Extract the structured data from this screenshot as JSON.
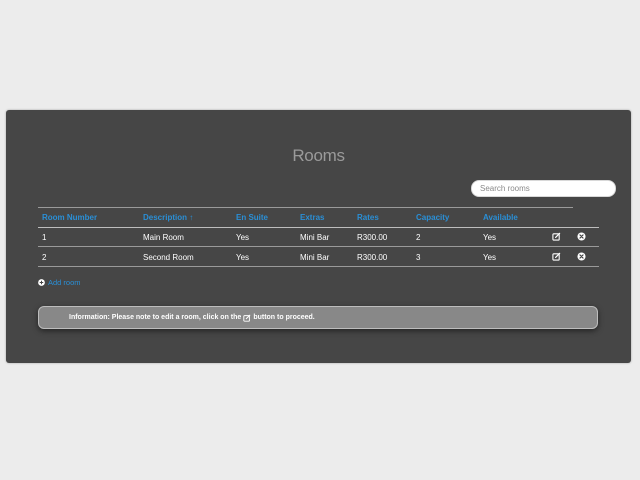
{
  "page": {
    "title": "Rooms"
  },
  "search": {
    "placeholder": "Search rooms"
  },
  "table": {
    "columns": [
      "Room Number",
      "Description ↑",
      "En Suite",
      "Extras",
      "Rates",
      "Capacity",
      "Available"
    ],
    "rows": [
      {
        "room_number": "1",
        "description": "Main Room",
        "en_suite": "Yes",
        "extras": "Mini Bar",
        "rates": "R300.00",
        "capacity": "2",
        "available": "Yes"
      },
      {
        "room_number": "2",
        "description": "Second Room",
        "en_suite": "Yes",
        "extras": "Mini Bar",
        "rates": "R300.00",
        "capacity": "3",
        "available": "Yes"
      }
    ],
    "row_actions": [
      "edit-icon",
      "remove-icon"
    ]
  },
  "add_room": {
    "label": "Add room",
    "icon": "plus-circle-icon"
  },
  "info": {
    "text_before": "Information: Please note to edit a room, click on the",
    "icon": "edit-icon",
    "text_after": "button to proceed."
  },
  "colors": {
    "background": "#ececec",
    "panel": "#464646",
    "accent": "#2a8fd6",
    "info_box": "#888888"
  }
}
